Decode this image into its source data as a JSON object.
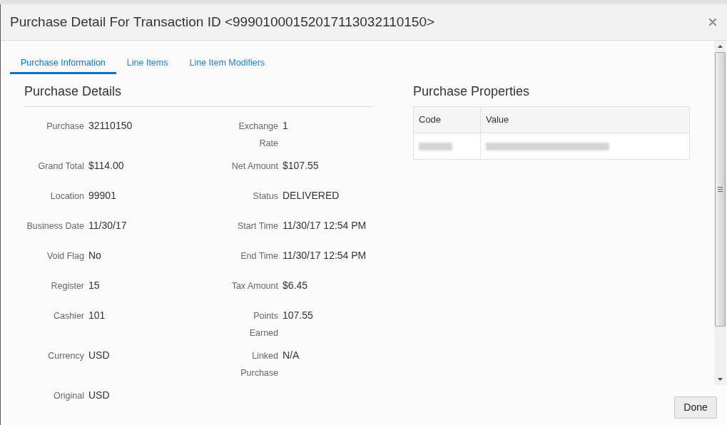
{
  "dialog": {
    "title": "Purchase Detail For Transaction ID <99901000152017113032110150>"
  },
  "tabs": [
    {
      "label": "Purchase Information",
      "selected": true
    },
    {
      "label": "Line Items",
      "selected": false
    },
    {
      "label": "Line Item Modifiers",
      "selected": false
    }
  ],
  "purchase_details": {
    "heading": "Purchase Details",
    "columns": [
      [
        {
          "label": "Purchase",
          "value": "32110150"
        },
        {
          "label": "Grand Total",
          "value": "$114.00"
        },
        {
          "label": "Location",
          "value": "99901"
        },
        {
          "label": "Business Date",
          "value": "11/30/17"
        },
        {
          "label": "Void Flag",
          "value": "No"
        },
        {
          "label": "Register",
          "value": "15"
        },
        {
          "label": "Cashier",
          "value": "101"
        },
        {
          "label": "Currency",
          "value": "USD"
        },
        {
          "label": "Original",
          "value": "USD"
        }
      ],
      [
        {
          "label": "Exchange Rate",
          "value": "1"
        },
        {
          "label": "Net Amount",
          "value": "$107.55"
        },
        {
          "label": "Status",
          "value": "DELIVERED"
        },
        {
          "label": "Start Time",
          "value": "11/30/17 12:54 PM"
        },
        {
          "label": "End Time",
          "value": "11/30/17 12:54 PM"
        },
        {
          "label": "Tax Amount",
          "value": "$6.45"
        },
        {
          "label": "Points Earned",
          "value": "107.55"
        },
        {
          "label": "Linked Purchase",
          "value": "N/A"
        }
      ]
    ]
  },
  "purchase_properties": {
    "heading": "Purchase Properties",
    "columns": [
      "Code",
      "Value"
    ],
    "rows": [
      {
        "cells": [
          {
            "kind": "redacted"
          },
          {
            "kind": "redacted"
          }
        ]
      }
    ]
  },
  "footer": {
    "buttons": [
      "Done"
    ]
  }
}
